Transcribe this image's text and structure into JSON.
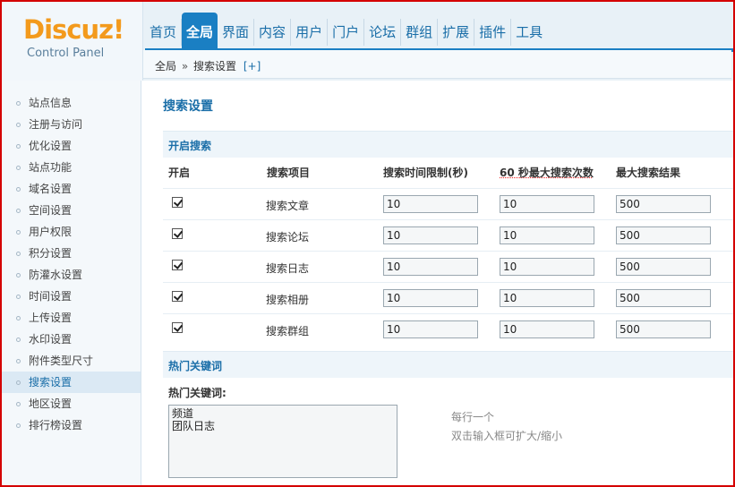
{
  "logo": {
    "main": "Discuz!",
    "sub": "Control Panel"
  },
  "nav": {
    "items": [
      "首页",
      "全局",
      "界面",
      "内容",
      "用户",
      "门户",
      "论坛",
      "群组",
      "扩展",
      "插件",
      "工具"
    ],
    "active_index": 1
  },
  "breadcrumb": {
    "root": "全局",
    "separator": "»",
    "current": "搜索设置",
    "add": "[+]"
  },
  "sidebar": {
    "items": [
      "站点信息",
      "注册与访问",
      "优化设置",
      "站点功能",
      "域名设置",
      "空间设置",
      "用户权限",
      "积分设置",
      "防灌水设置",
      "时间设置",
      "上传设置",
      "水印设置",
      "附件类型尺寸",
      "搜索设置",
      "地区设置",
      "排行榜设置"
    ],
    "active_index": 13
  },
  "page": {
    "title": "搜索设置"
  },
  "search_section": {
    "title": "开启搜索",
    "columns": [
      "开启",
      "搜索项目",
      "搜索时间限制(秒)",
      "60 秒最大搜索次数",
      "最大搜索结果"
    ],
    "rows": [
      {
        "enabled": true,
        "label": "搜索文章",
        "time_limit": "10",
        "max_count": "10",
        "max_results": "500"
      },
      {
        "enabled": true,
        "label": "搜索论坛",
        "time_limit": "10",
        "max_count": "10",
        "max_results": "500"
      },
      {
        "enabled": true,
        "label": "搜索日志",
        "time_limit": "10",
        "max_count": "10",
        "max_results": "500"
      },
      {
        "enabled": true,
        "label": "搜索相册",
        "time_limit": "10",
        "max_count": "10",
        "max_results": "500"
      },
      {
        "enabled": true,
        "label": "搜索群组",
        "time_limit": "10",
        "max_count": "10",
        "max_results": "500"
      }
    ]
  },
  "hot_section": {
    "title": "热门关键词",
    "field_label": "热门关键词:",
    "value": "频道\n团队日志",
    "hint_1": "每行一个",
    "hint_2": "双击输入框可扩大/缩小"
  },
  "colors": {
    "accent": "#1a7fc3",
    "logo": "#f39a1c",
    "frame": "#d40000"
  }
}
